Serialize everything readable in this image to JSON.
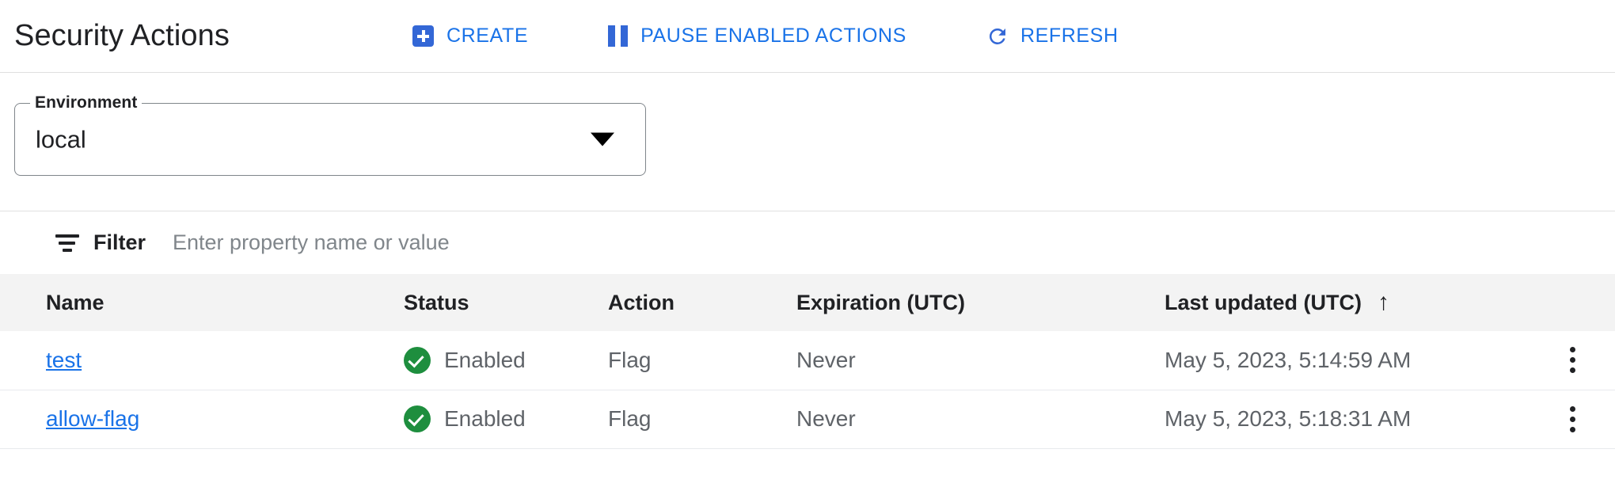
{
  "header": {
    "title": "Security Actions",
    "buttons": [
      {
        "id": "create",
        "label": "CREATE",
        "icon": "plus-icon"
      },
      {
        "id": "pause",
        "label": "PAUSE ENABLED ACTIONS",
        "icon": "pause-icon"
      },
      {
        "id": "refresh",
        "label": "REFRESH",
        "icon": "refresh-icon"
      }
    ]
  },
  "environment": {
    "label": "Environment",
    "value": "local",
    "arrow_icon": "chevron-down-icon"
  },
  "filter": {
    "icon": "filter-list-icon",
    "label": "Filter",
    "placeholder": "Enter property name or value",
    "value": ""
  },
  "table": {
    "columns": [
      {
        "key": "name",
        "label": "Name"
      },
      {
        "key": "status",
        "label": "Status"
      },
      {
        "key": "action",
        "label": "Action"
      },
      {
        "key": "expiration",
        "label": "Expiration (UTC)"
      },
      {
        "key": "last_updated",
        "label": "Last updated (UTC)",
        "sort": "ascending",
        "sort_icon": "arrow-up-icon"
      }
    ],
    "rows": [
      {
        "name": "test",
        "status": "Enabled",
        "status_icon": "check-circle-icon",
        "action": "Flag",
        "expiration": "Never",
        "last_updated": "May 5, 2023, 5:14:59 AM",
        "menu_icon": "more-vert-icon"
      },
      {
        "name": "allow-flag",
        "status": "Enabled",
        "status_icon": "check-circle-icon",
        "action": "Flag",
        "expiration": "Never",
        "last_updated": "May 5, 2023, 5:18:31 AM",
        "menu_icon": "more-vert-icon"
      }
    ]
  },
  "colors": {
    "accent_blue": "#1a73e8",
    "icon_blue": "#3367d6",
    "status_green": "#1e8e3e",
    "header_bg": "#f3f3f3",
    "divider": "#e0e0e0",
    "text_primary": "#202124",
    "text_secondary": "#5f6368"
  }
}
